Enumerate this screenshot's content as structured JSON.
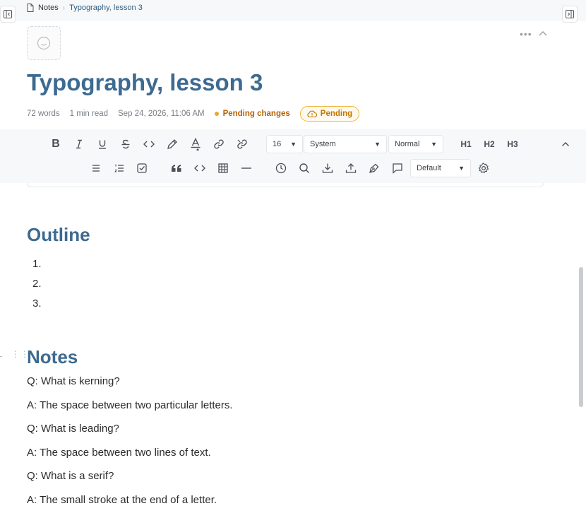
{
  "breadcrumb": {
    "root": "Notes",
    "current": "Typography, lesson 3"
  },
  "document": {
    "title": "Typography, lesson 3",
    "meta": {
      "words": "72 words",
      "read_time": "1 min read",
      "timestamp": "Sep 24, 2026, 11:06 AM",
      "status": "Pending changes",
      "badge": "Pending"
    }
  },
  "toolbar": {
    "row1": {
      "bold": "B",
      "heading1": "H1",
      "heading2": "H2",
      "heading3": "H3",
      "font_size": "16",
      "font_family": "System",
      "text_style": "Normal"
    },
    "row2": {
      "style_select": "Default"
    }
  },
  "content": {
    "outline_heading": "Outline",
    "outline_items": [
      "1.",
      "2.",
      "3."
    ],
    "notes_heading": "Notes",
    "notes": [
      "Q: What is kerning?",
      "A: The space between two particular letters.",
      "Q: What is leading?",
      "A: The space between two lines of text.",
      "Q: What is a serif?",
      "A: The small stroke at the end of a letter."
    ]
  },
  "colors": {
    "accent": "#3d6a90",
    "pending": "#f0a429",
    "pending_text": "#b55f00"
  }
}
